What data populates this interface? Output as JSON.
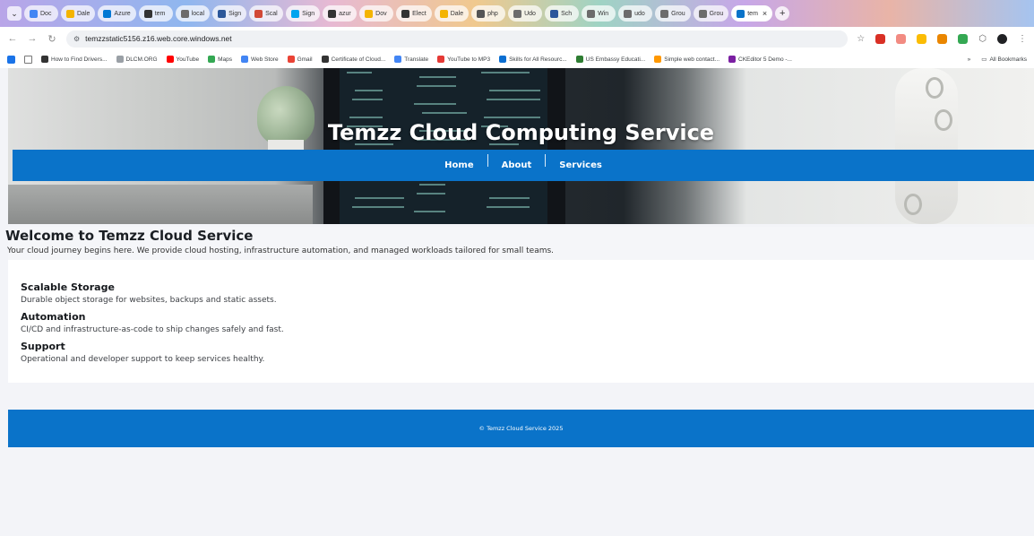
{
  "browser": {
    "tabs": [
      {
        "label": "Doc",
        "color": "#4285f4"
      },
      {
        "label": "Dale",
        "color": "#f4b400"
      },
      {
        "label": "Azure",
        "color": "#0078d4"
      },
      {
        "label": "tem",
        "color": "#333333"
      },
      {
        "label": "local",
        "color": "#6c6c6c"
      },
      {
        "label": "Sign",
        "color": "#2b579a"
      },
      {
        "label": "Scal",
        "color": "#d14836"
      },
      {
        "label": "Sign",
        "color": "#00a4ef"
      },
      {
        "label": "azur",
        "color": "#333333"
      },
      {
        "label": "Dov",
        "color": "#f4b400"
      },
      {
        "label": "Elect",
        "color": "#333333"
      },
      {
        "label": "Dale",
        "color": "#f4b400"
      },
      {
        "label": "php",
        "color": "#555555"
      },
      {
        "label": "Udo",
        "color": "#6c6c6c"
      },
      {
        "label": "Sch",
        "color": "#2b579a"
      },
      {
        "label": "Win",
        "color": "#6c6c6c"
      },
      {
        "label": "udo",
        "color": "#6c6c6c"
      },
      {
        "label": "Grou",
        "color": "#6c6c6c"
      },
      {
        "label": "Grou",
        "color": "#6c6c6c"
      }
    ],
    "active_tab": "tem",
    "address": "temzzstatic5156.z16.web.core.windows.net",
    "bookmarks": [
      {
        "label": "How to Find Drivers...",
        "color": "#333333"
      },
      {
        "label": "DLCM.ORG",
        "color": "#9aa0a6"
      },
      {
        "label": "YouTube",
        "color": "#ff0000"
      },
      {
        "label": "Maps",
        "color": "#34a853"
      },
      {
        "label": "Web Store",
        "color": "#4285f4"
      },
      {
        "label": "Gmail",
        "color": "#ea4335"
      },
      {
        "label": "Certificate of Cloud...",
        "color": "#333333"
      },
      {
        "label": "Translate",
        "color": "#4285f4"
      },
      {
        "label": "YouTube to MP3",
        "color": "#e53935"
      },
      {
        "label": "Skills for All Resourc...",
        "color": "#0a6ed1"
      },
      {
        "label": "US Embassy Educati...",
        "color": "#2e7d32"
      },
      {
        "label": "Simple web contact...",
        "color": "#ff9800"
      },
      {
        "label": "CKEditor 5 Demo -...",
        "color": "#7b1fa2"
      }
    ],
    "all_bookmarks": "All Bookmarks"
  },
  "site": {
    "hero_title": "Temzz Cloud Computing Service",
    "nav": [
      "Home",
      "About",
      "Services"
    ],
    "welcome_title": "Welcome to Temzz Cloud Service",
    "welcome_text": "Your cloud journey begins here. We provide cloud hosting, infrastructure automation, and managed workloads tailored for small teams.",
    "features": [
      {
        "title": "Scalable Storage",
        "text": "Durable object storage for websites, backups and static assets."
      },
      {
        "title": "Automation",
        "text": "CI/CD and infrastructure-as-code to ship changes safely and fast."
      },
      {
        "title": "Support",
        "text": "Operational and developer support to keep services healthy."
      }
    ],
    "footer": "© Temzz Cloud Service 2025",
    "accent": "#0a73c9"
  }
}
